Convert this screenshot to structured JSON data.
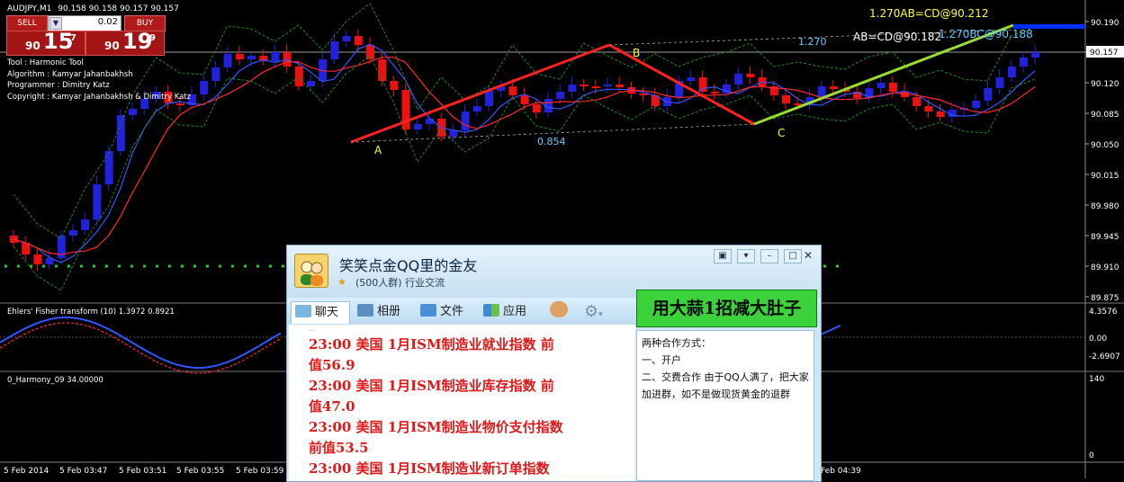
{
  "chart": {
    "symbol": "AUDJPY,M1",
    "ohlc": "90.158 90.158 90.157 90.157",
    "info": {
      "tool": "Tool        : Harmonic Tool",
      "algorithm": "Algorithm    : Kamyar Jahanbakhsh",
      "programmer": "Programmer  : Dimitry Katz",
      "copyright": "Copyright     : Kamyar Jahanbakhsh & Dimitry Katz"
    },
    "price_axis": [
      "90.190",
      "90.155",
      "90.120",
      "90.085",
      "90.050",
      "90.015",
      "89.980",
      "89.945",
      "89.910",
      "89.875"
    ],
    "current_price": "90.157",
    "pattern_labels": {
      "a": "A",
      "b": "B",
      "c": "C",
      "ab_bc": "0.854",
      "bc_ext": "1.270"
    },
    "targets": {
      "t1": "1.270AB=CD@90.212",
      "t2": "AB=CD@90.182",
      "t3": "1.270BC@90.188"
    },
    "indicator1": {
      "title": "Ehlers' Fisher transform (10) 1.3972 0.8921",
      "axis": [
        "4.3576",
        "0.00",
        "-2.6907"
      ]
    },
    "indicator2": {
      "title": "0_Harmony_09 34.00000",
      "axis": [
        "140",
        "0"
      ]
    },
    "time_axis": [
      "5 Feb 2014",
      "5 Feb 03:47",
      "5 Feb 03:51",
      "5 Feb 03:55",
      "5 Feb 03:59",
      "Feb 04:39"
    ],
    "colors": {
      "bull": "#2222dd",
      "bear": "#ee1111",
      "zigzag": "#ff2020",
      "projection": "#99dd33",
      "target_bar": "#0030ff",
      "ma_red": "#ff2a2a",
      "ma_blue": "#3355ff",
      "envelope": "#1e8a1e"
    }
  },
  "trade_panel": {
    "sell_label": "SELL",
    "buy_label": "BUY",
    "lot": "0.02",
    "sell_price": {
      "prefix": "90",
      "big": "15",
      "sup": "7"
    },
    "buy_price": {
      "prefix": "90",
      "big": "19",
      "sup": "9"
    }
  },
  "qq_window": {
    "title": "笑笑点金QQ里的金友",
    "subtitle": "(500人群) 行业交流",
    "tabs": [
      "聊天",
      "相册",
      "文件",
      "应用"
    ],
    "ad_text": "用大蒜1招减大肚子",
    "messages": [
      "23:00 美国 1月ISM制造业就业指数 前",
      "值56.9",
      "23:00 美国 1月ISM制造业库存指数 前",
      "值47.0",
      "23:00 美国 1月ISM制造业物价支付指数",
      "前值53.5",
      "23:00 美国 1月ISM制造业新订单指数"
    ],
    "side_lines": [
      "两种合作方式：",
      "一、开户",
      "二、交费合作 由于QQ人满了，把大家加进群，如不是做现货黄金的退群"
    ]
  }
}
